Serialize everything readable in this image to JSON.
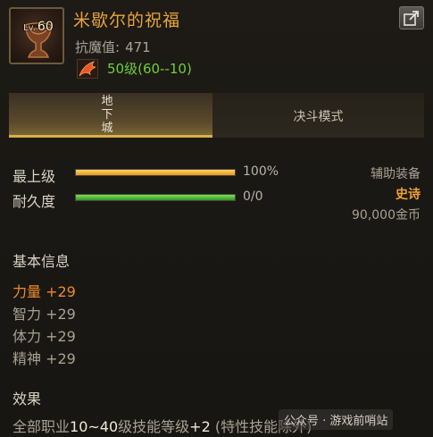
{
  "header": {
    "level_prefix": "Lv.",
    "level": "60",
    "item_name": "米歇尔的祝福",
    "magic_resist_label": "抗魔值:",
    "magic_resist_value": "471",
    "required_level": "50级(60--10)"
  },
  "tabs": [
    {
      "label": "地下城",
      "active": true
    },
    {
      "label": "决斗模式",
      "active": false
    }
  ],
  "stats": {
    "grade_label": "最上级",
    "grade_value": "100%",
    "grade_fill": 1.0,
    "durability_label": "耐久度",
    "durability_value": "0/0",
    "durability_fill": 1.0
  },
  "item_meta": {
    "sub_type": "辅助装备",
    "rarity": "史诗",
    "price": "90,000金币"
  },
  "basic_info": {
    "title": "基本信息",
    "attributes": [
      "力量 +29",
      "智力 +29",
      "体力 +29",
      "精神 +29"
    ]
  },
  "effect": {
    "title": "效果",
    "line_prefix": "全部职业",
    "line_range": "10~40",
    "line_middle": "级技能等级",
    "line_bonus": "+2",
    "line_suffix": "(特性技能除外)"
  },
  "watermark": "公众号 · 游戏前哨站",
  "colors": {
    "item_name": "#e8a43a",
    "required_level": "#6fce3a",
    "rarity": "#f0a035",
    "highlight_attr": "#f08a2a",
    "tab_accent": "#d8b04a"
  }
}
